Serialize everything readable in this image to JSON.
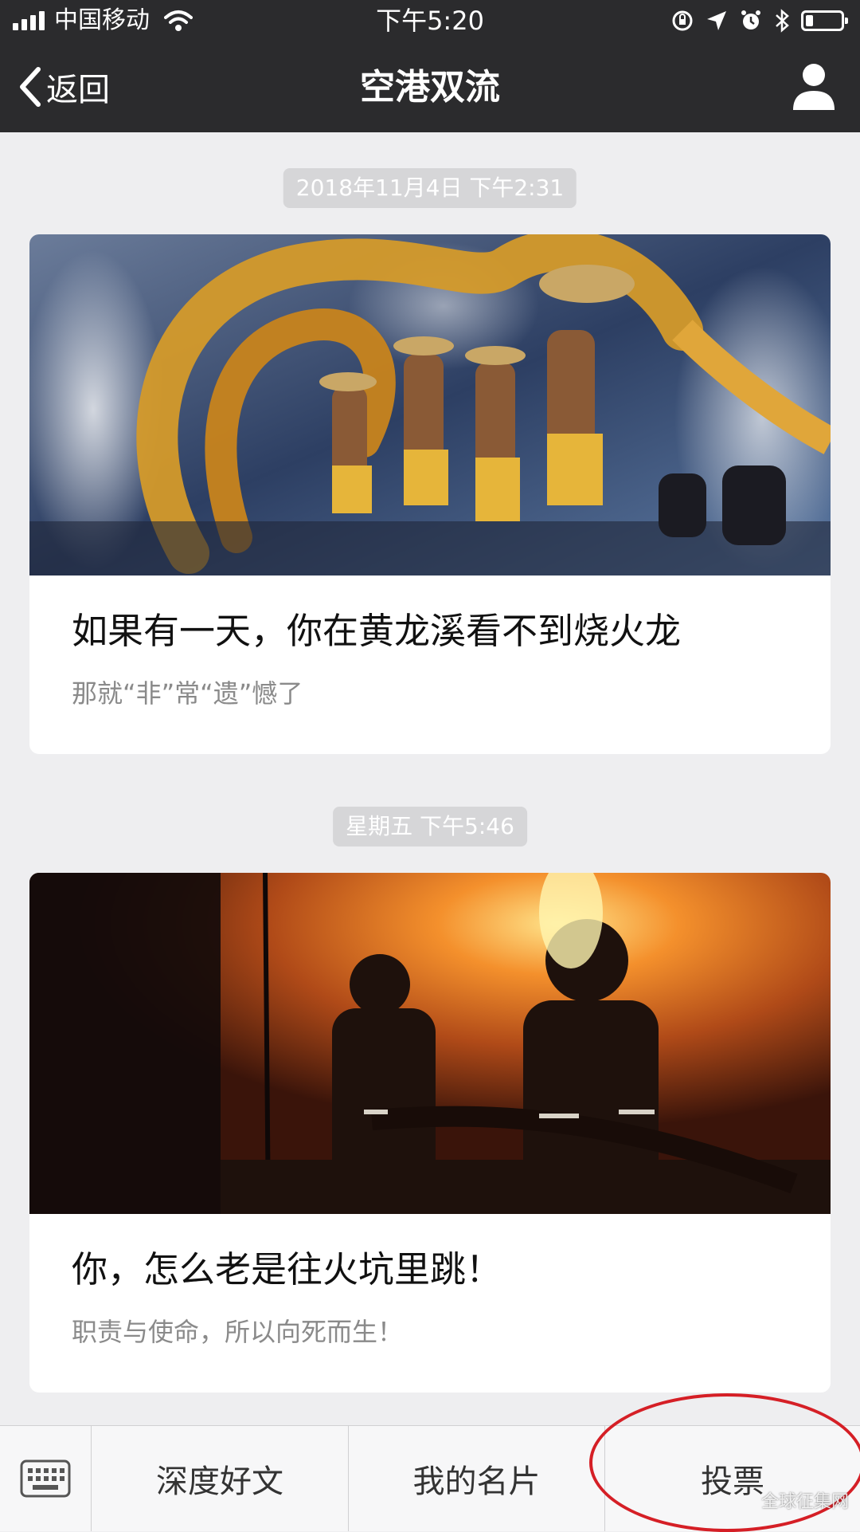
{
  "status_bar": {
    "carrier": "中国移动",
    "time": "下午5:20",
    "battery_level": 0.22
  },
  "nav": {
    "back_label": "返回",
    "title": "空港双流"
  },
  "messages": [
    {
      "timestamp": "2018年11月4日 下午2:31",
      "title": "如果有一天，你在黄龙溪看不到烧火龙",
      "subtitle": "那就“非”常“遗”憾了"
    },
    {
      "timestamp": "星期五 下午5:46",
      "title": "你，怎么老是往火坑里跳！",
      "subtitle": "职责与使命，所以向死而生！"
    }
  ],
  "menu": {
    "items": [
      "深度好文",
      "我的名片",
      "投票"
    ]
  },
  "watermark": "全球征集网",
  "colors": {
    "topbar": "#2b2b2d",
    "annotation_circle": "#d51f26"
  }
}
